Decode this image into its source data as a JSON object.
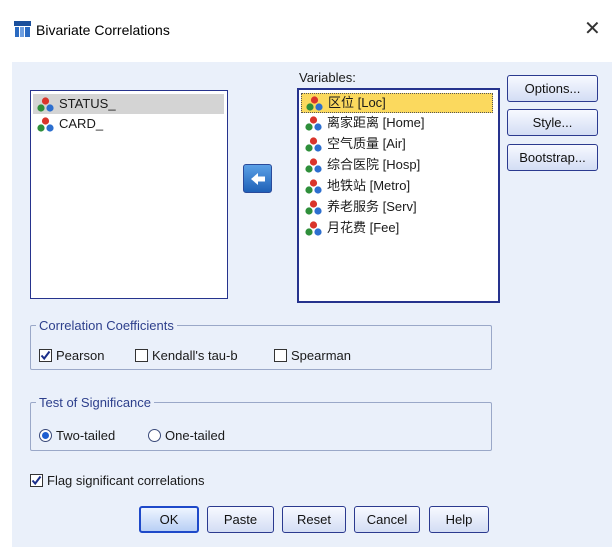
{
  "window": {
    "title": "Bivariate Correlations",
    "close_glyph": "✕"
  },
  "source_list": {
    "items": [
      {
        "label": "STATUS_",
        "selected": true
      },
      {
        "label": "CARD_",
        "selected": false
      }
    ]
  },
  "variables": {
    "label": "Variables:",
    "items": [
      {
        "label": "区位 [Loc]",
        "selected": true
      },
      {
        "label": "离家距离 [Home]"
      },
      {
        "label": "空气质量 [Air]"
      },
      {
        "label": "综合医院 [Hosp]"
      },
      {
        "label": "地铁站 [Metro]"
      },
      {
        "label": "养老服务 [Serv]"
      },
      {
        "label": "月花费 [Fee]"
      }
    ]
  },
  "side_buttons": {
    "options": "Options...",
    "style": "Style...",
    "bootstrap": "Bootstrap..."
  },
  "coefficients": {
    "title": "Correlation Coefficients",
    "pearson": "Pearson",
    "pearson_checked": true,
    "kendall": "Kendall's tau-b",
    "kendall_checked": false,
    "spearman": "Spearman",
    "spearman_checked": false
  },
  "significance": {
    "title": "Test of Significance",
    "two_tailed": "Two-tailed",
    "one_tailed": "One-tailed",
    "selected": "two_tailed"
  },
  "flag": {
    "label": "Flag significant correlations",
    "checked": true
  },
  "footer": {
    "ok": "OK",
    "paste": "Paste",
    "reset": "Reset",
    "cancel": "Cancel",
    "help": "Help"
  },
  "colors": {
    "accent": "#1e49c9",
    "panel": "#eaf0fa",
    "selected_gray": "#d4d4d4",
    "selected_yellow": "#fbd95e"
  },
  "icons": {
    "variable": "nominal-variable-icon",
    "move": "arrow-left-icon",
    "app": "spss-dialog-icon"
  }
}
